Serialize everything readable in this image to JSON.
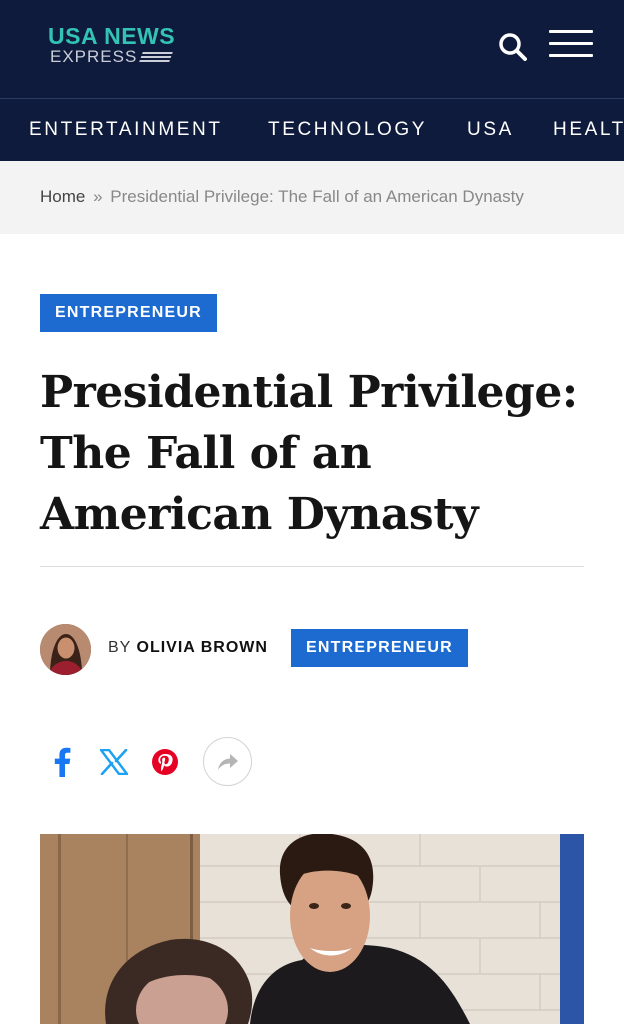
{
  "header": {
    "logo_top": "USA NEWS",
    "logo_bottom": "EXPRESS"
  },
  "nav": {
    "items": [
      "ENTERTAINMENT",
      "TECHNOLOGY",
      "USA",
      "HEALT"
    ]
  },
  "breadcrumb": {
    "home": "Home",
    "separator": "»",
    "current": "Presidential Privilege: The Fall of an American Dynasty"
  },
  "article": {
    "category": "ENTREPRENEUR",
    "title": "Presidential Privilege: The Fall of an American Dynasty",
    "byline_prefix": "BY",
    "author": "OLIVIA BROWN",
    "meta_category": "ENTREPRENEUR"
  },
  "share": {
    "icons": [
      "facebook-icon",
      "x-icon",
      "pinterest-icon",
      "share-arrow-icon"
    ]
  },
  "colors": {
    "header_bg": "#0f1b3c",
    "logo_accent": "#33c3b4",
    "badge_blue": "#1d6bd1",
    "facebook": "#1877f2",
    "x_blue": "#1da1f2",
    "pinterest": "#e60023"
  }
}
